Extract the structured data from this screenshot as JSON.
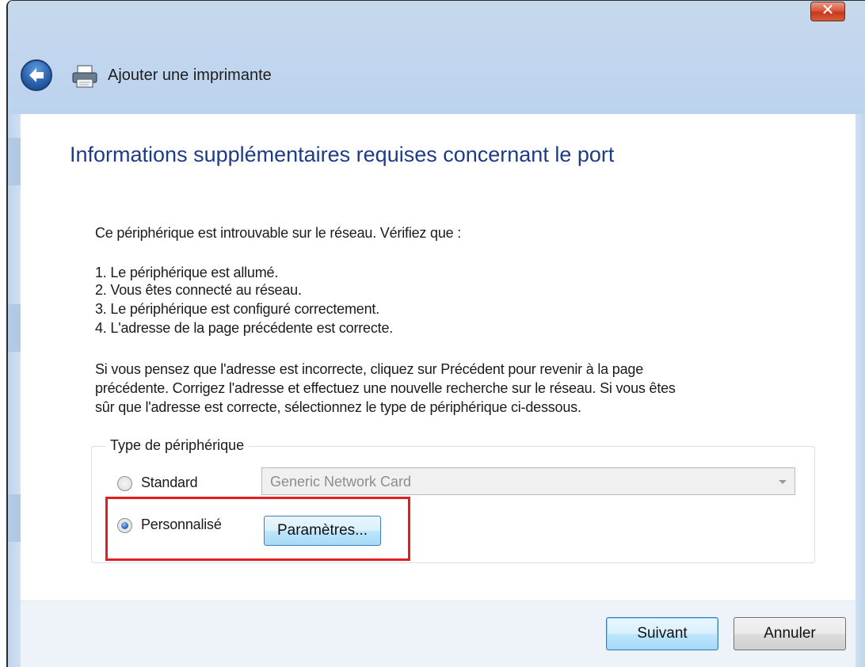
{
  "window": {
    "title": "Ajouter une imprimante",
    "close_glyph": "✕",
    "back_icon": "back-arrow-icon",
    "title_icon": "printer-icon"
  },
  "page": {
    "heading": "Informations supplémentaires requises concernant le port",
    "intro": "Ce périphérique est introuvable sur le réseau. Vérifiez que :",
    "checklist": [
      "1.  Le périphérique est allumé.",
      "2.  Vous êtes connecté au réseau.",
      "3.  Le périphérique est configuré correctement.",
      "4.  L'adresse de la page précédente est correcte."
    ],
    "advice_lines": [
      "Si vous pensez que l'adresse est incorrecte, cliquez sur Précédent pour revenir à la page",
      "précédente. Corrigez l'adresse et effectuez une nouvelle recherche sur le réseau. Si vous êtes",
      "sûr que l'adresse est correcte, sélectionnez le type de périphérique ci-dessous."
    ]
  },
  "device_type": {
    "legend": "Type de périphérique",
    "standard_label": "Standard",
    "standard_selected": false,
    "standard_value": "Generic Network Card",
    "custom_label": "Personnalisé",
    "custom_selected": true,
    "settings_button": "Paramètres..."
  },
  "footer": {
    "next_button": "Suivant",
    "cancel_button": "Annuler"
  },
  "colors": {
    "heading": "#1e3b87",
    "highlight": "#e02020",
    "chrome": "#c2d6ee"
  }
}
